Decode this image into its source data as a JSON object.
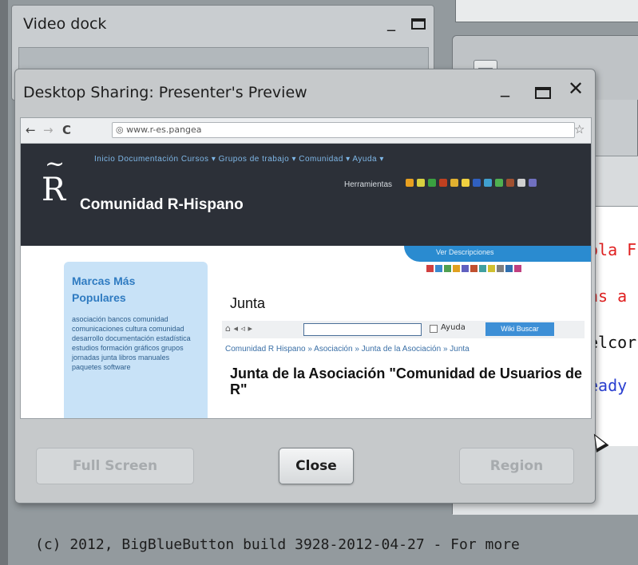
{
  "background": {
    "video_dock_title": "Video dock",
    "chat_lines": [
      {
        "text": "ola F",
        "color": "#e02020"
      },
      {
        "text": "ns a",
        "color": "#e02020"
      },
      {
        "text": "elcor",
        "color": "#111111"
      },
      {
        "text": "eady",
        "color": "#2a3fd0"
      }
    ],
    "footer": "(c) 2012, BigBlueButton build 3928-2012-04-27 - For more"
  },
  "dialog": {
    "title": "Desktop Sharing: Presenter's Preview",
    "minimize_glyph": "_",
    "close_glyph": "✕",
    "buttons": {
      "full_screen": "Full Screen",
      "close": "Close",
      "region": "Region"
    }
  },
  "shared_screen": {
    "browser": {
      "back": "←",
      "forward": "→",
      "reload": "C",
      "url": "◎ www.r-es.pangea",
      "star": "☆"
    },
    "site": {
      "logo_tilde": "~",
      "logo_letter": "R",
      "name": "Comunidad R-Hispano",
      "menu": "Inicio  Documentación  Cursos ▾  Grupos de trabajo ▾  Comunidad ▾  Ayuda ▾",
      "tools_label": "Herramientas",
      "swoosh_text": "Ver Descripciones",
      "sidebar_title": "Marcas Más Populares",
      "sidebar_links": "asociación  bancos  comunidad  comunicaciones  cultura  comunidad  desarrollo  documentación  estadística  estudios  formación  gráficos  grupos  jornadas  junta  libros  manuales  paquetes  software",
      "page_heading": "Junta",
      "wiki_nav": "⌂ ◂ ◃ ▸",
      "wiki_check_label": "Ayuda",
      "wiki_button": "Wiki Buscar",
      "breadcrumb": "Comunidad R Hispano » Asociación » Junta de la Asociación » Junta",
      "article_title": "Junta de la Asociación \"Comunidad de Usuarios de R\""
    },
    "tool_icon_colors": [
      "#e8a020",
      "#d8d040",
      "#3aa040",
      "#c04020",
      "#e0b030",
      "#f0d040",
      "#3060c0",
      "#40a0d0",
      "#50b050",
      "#a05030",
      "#d0d0d0",
      "#7070c0"
    ],
    "small_icon_colors": [
      "#d04040",
      "#3a8ad0",
      "#50a050",
      "#e0a020",
      "#6060c0",
      "#c05030",
      "#40a0a0",
      "#d0c030",
      "#7f7f7f",
      "#3070b0",
      "#c04080"
    ]
  }
}
